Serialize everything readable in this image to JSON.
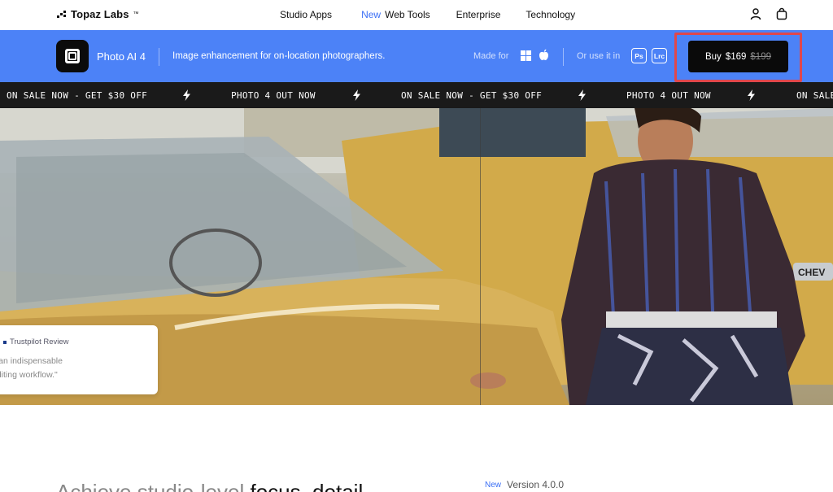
{
  "brand": {
    "logo_text": "Topaz Labs",
    "logo_tm": "™"
  },
  "nav": {
    "studio_apps": "Studio Apps",
    "new_badge": "New",
    "web_tools": "Web Tools",
    "enterprise": "Enterprise",
    "technology": "Technology",
    "icons": [
      "user-icon",
      "bag-icon"
    ]
  },
  "product_bar": {
    "app_name": "Photo AI 4",
    "tagline": "Image enhancement for on-location photographers.",
    "made_for": "Made for",
    "platforms": [
      "windows-icon",
      "apple-icon"
    ],
    "or_use": "Or use it in",
    "plugins": [
      "Ps",
      "Lrc"
    ],
    "buy_label": "Buy",
    "price": "$169",
    "old_price": "$199",
    "bar_color": "#4c82f7"
  },
  "ticker": {
    "items": [
      "ON SALE NOW - GET $30 OFF",
      "PHOTO 4 OUT NOW",
      "ON SALE NOW - GET $30 OFF",
      "PHOTO 4 OUT NOW",
      "ON SALE NOW - GET $30 OFF"
    ]
  },
  "hero": {
    "review_source": "Trustpilot Review",
    "review_line1": "s an indispensable",
    "review_line2": "editing workflow.\"",
    "badge_text": "CHEV"
  },
  "section": {
    "headline_light": "Achieve studio-level",
    "headline_bold": "focus, detail",
    "version_new": "New",
    "version": "Version 4.0.0"
  },
  "colors": {
    "accent": "#3b6ff5",
    "highlight": "#e0474c",
    "ticker_bg": "#1a1a1a"
  }
}
